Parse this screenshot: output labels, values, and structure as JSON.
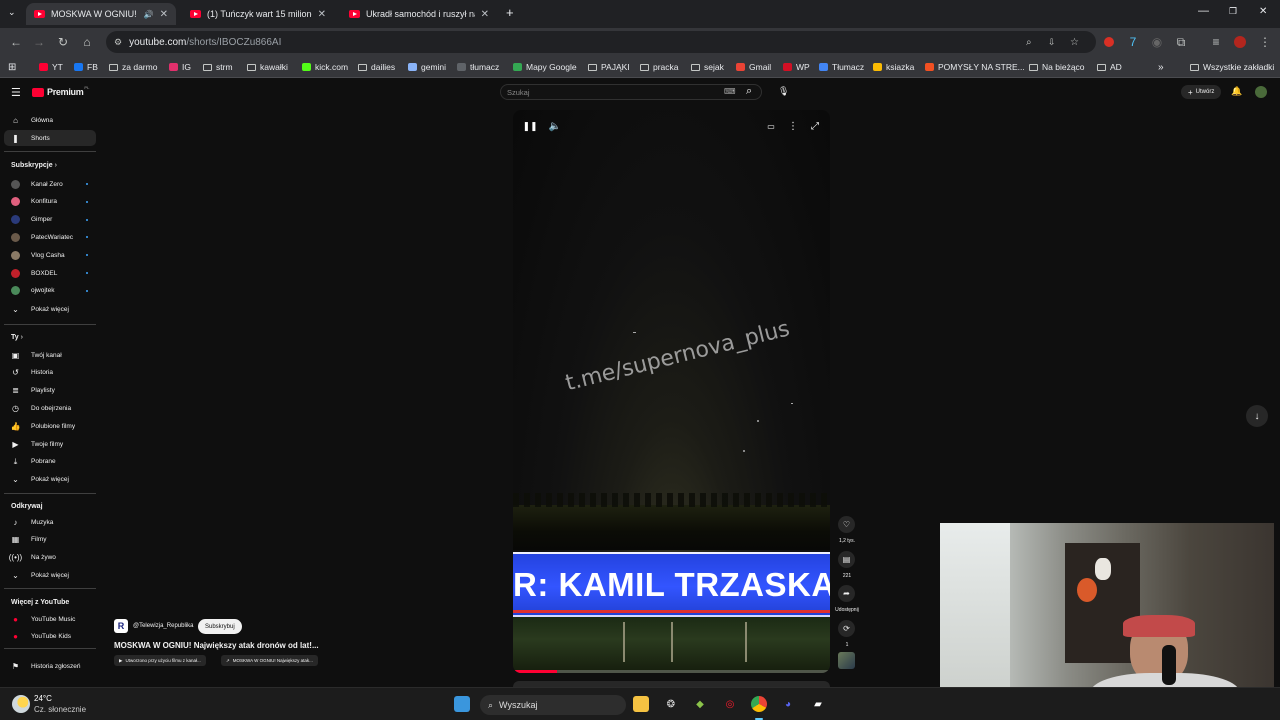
{
  "tabs": [
    {
      "title": "MOSKWA W OGNIU! Najwię",
      "active": true
    },
    {
      "title": "(1) Tuńczyk wart 15 milionów d",
      "active": false
    },
    {
      "title": "Ukradł samochód i ruszył na ro",
      "active": false
    }
  ],
  "address_bar": {
    "host": "youtube.com",
    "path": "/shorts/IBOCZu866AI"
  },
  "bookmarks": [
    {
      "label": "YT",
      "color": "#ff0033"
    },
    {
      "label": "FB",
      "color": "#1877f2"
    },
    {
      "label": "za darmo",
      "color": "folder"
    },
    {
      "label": "IG",
      "color": "#e1306c"
    },
    {
      "label": "strm",
      "color": "folder"
    },
    {
      "label": "kawałki",
      "color": "folder"
    },
    {
      "label": "kick.com",
      "color": "#53fc18"
    },
    {
      "label": "dailies",
      "color": "folder"
    },
    {
      "label": "gemini",
      "color": "#8ab4f8"
    },
    {
      "label": "tłumacz",
      "color": "#5f6368"
    },
    {
      "label": "Mapy Google",
      "color": "#34a853"
    },
    {
      "label": "PAJĄKI",
      "color": "folder"
    },
    {
      "label": "pracka",
      "color": "folder"
    },
    {
      "label": "sejak",
      "color": "folder"
    },
    {
      "label": "Gmail",
      "color": "#ea4335"
    },
    {
      "label": "WP",
      "color": "#d20f24"
    },
    {
      "label": "Tłumacz",
      "color": "#4285f4"
    },
    {
      "label": "ksiazka",
      "color": "#fbbc04"
    },
    {
      "label": "POMYSŁY NA STRE...",
      "color": "#f25022"
    },
    {
      "label": "Na bieżąco",
      "color": "folder"
    },
    {
      "label": "AD",
      "color": "folder"
    }
  ],
  "bookmarks_all": "Wszystkie zakładki",
  "yt": {
    "logo": "Premium",
    "logo_sup": "PL",
    "search_placeholder": "Szukaj",
    "create_label": "Utwórz"
  },
  "sidebar": {
    "main": [
      {
        "label": "Główna",
        "icon": "home-icon"
      },
      {
        "label": "Shorts",
        "icon": "shorts-icon",
        "active": true
      }
    ],
    "subs_header": "Subskrypcje",
    "subs": [
      {
        "label": "Kanał Zero",
        "color": "#555"
      },
      {
        "label": "Konfitura",
        "color": "#e0607e"
      },
      {
        "label": "Gimper",
        "color": "#2a3a7a"
      },
      {
        "label": "PatecWariatec",
        "color": "#6a5a4a"
      },
      {
        "label": "Vlog Casha",
        "color": "#8a7a66"
      },
      {
        "label": "BOXDEL",
        "color": "#c0202a"
      },
      {
        "label": "ojwojtek",
        "color": "#4a8a5a"
      }
    ],
    "show_more_1": "Pokaż więcej",
    "you_header": "Ty",
    "you": [
      {
        "label": "Twój kanał",
        "icon": "channel-icon"
      },
      {
        "label": "Historia",
        "icon": "history-icon"
      },
      {
        "label": "Playlisty",
        "icon": "playlist-icon"
      },
      {
        "label": "Do obejrzenia",
        "icon": "watch-later-icon"
      },
      {
        "label": "Polubione filmy",
        "icon": "like-icon"
      },
      {
        "label": "Twoje filmy",
        "icon": "your-videos-icon"
      },
      {
        "label": "Pobrane",
        "icon": "download-icon"
      },
      {
        "label": "Pokaż więcej",
        "icon": "chevron-down-icon"
      }
    ],
    "explore_header": "Odkrywaj",
    "explore": [
      {
        "label": "Muzyka",
        "icon": "music-icon"
      },
      {
        "label": "Filmy",
        "icon": "film-icon"
      },
      {
        "label": "Na żywo",
        "icon": "live-icon"
      },
      {
        "label": "Pokaż więcej",
        "icon": "chevron-down-icon"
      }
    ],
    "more_header": "Więcej z YouTube",
    "more": [
      {
        "label": "YouTube Music"
      },
      {
        "label": "YouTube Kids"
      }
    ],
    "report_history": "Historia zgłoszeń"
  },
  "video": {
    "watermark": "t.me/supernova_plus",
    "banner_text": "R: KAMIL TRZASKA",
    "progress_fraction": 0.14
  },
  "actions": {
    "likes": "1,2 tys.",
    "comments": "221",
    "share": "Udostępnij",
    "remix": "1"
  },
  "channel": {
    "handle": "@Telewizja_Republika",
    "subscribe": "Subskrybuj",
    "title": "MOSKWA W OGNIU! Największy atak dronów od lat!...",
    "chip1": "Utworzono przy użyciu filmu z kanał...",
    "chip2": "MOSKWA W OGNIU! Największy atak..."
  },
  "taskbar": {
    "temp": "24°C",
    "weather": "Cz. słonecznie",
    "search": "Wyszukaj"
  }
}
